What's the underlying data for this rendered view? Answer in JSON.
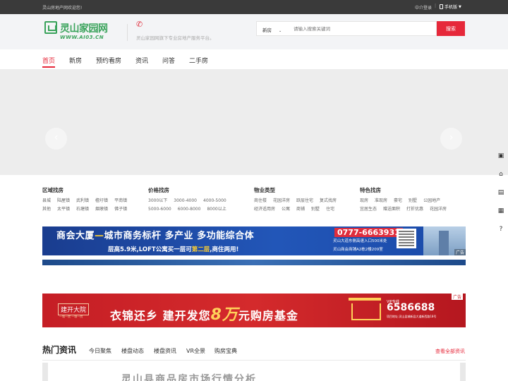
{
  "topbar": {
    "welcome": "灵山房地产网欢迎您!",
    "login": "中介登录",
    "separator": "|",
    "mobile": "手机版"
  },
  "header": {
    "logo_cn": "灵山家园网",
    "logo_en": "WWW.AI03.CN",
    "slogan": "灵山家园网旗下专业房地产服务平台。",
    "search": {
      "type_selected": "新房",
      "placeholder": "请输入搜索关键词",
      "button": "搜索"
    }
  },
  "nav": {
    "items": [
      {
        "label": "首页",
        "active": true
      },
      {
        "label": "新房"
      },
      {
        "label": "预约看房"
      },
      {
        "label": "资讯"
      },
      {
        "label": "问答"
      },
      {
        "label": "二手房"
      }
    ]
  },
  "banner": {
    "prev_icon": "chevron-left-icon",
    "next_icon": "chevron-right-icon"
  },
  "sidebar": {
    "icons": [
      "building-icon",
      "home-icon",
      "box-icon",
      "document-icon",
      "help-icon"
    ]
  },
  "categories": [
    {
      "title": "区域找房",
      "links": [
        "县城",
        "陆屋镇",
        "武利镇",
        "檀圩镇",
        "平南镇",
        "其他",
        "太平镇",
        "石塘镇",
        "烟墩镇",
        "佛子镇"
      ]
    },
    {
      "title": "价格找房",
      "links": [
        "3000以下",
        "3000-4000",
        "4000-5000",
        "5000-6000",
        "6000-8000",
        "8000以上"
      ]
    },
    {
      "title": "物业类型",
      "links": [
        "商住楼",
        "花园洋房",
        "跃层住宅",
        "复式找房",
        "经济适用房",
        "公寓",
        "商铺",
        "别墅",
        "住宅"
      ]
    },
    {
      "title": "特色找房",
      "links": [
        "现房",
        "准现房",
        "豪宅",
        "别墅",
        "公园地产",
        "宜居生态",
        "赠送面积",
        "打折优惠",
        "花园洋房"
      ]
    }
  ],
  "ad1": {
    "headline_a": "商会大厦",
    "headline_dash": "—",
    "headline_b": "城市商务标杆 多产业 多功能综合体",
    "sub_a": "层高5.9米,LOFT公寓买一层可",
    "sub_hl": "第二层",
    "sub_b": ",商住两用!",
    "tel": "0777-6663931",
    "addr1": "灵山大道东侧高速入口500米处",
    "addr2": "灵山商会商铺A2栋2楼209室",
    "tag": "广告"
  },
  "ad2": {
    "brand": "建开大院",
    "brand_sub": "一城一院 一城一院",
    "slogan_a": "衣锦还乡  建开发您",
    "slogan_big": "8万",
    "slogan_b": "元购房基金",
    "hotline": "VIP专线",
    "num": "6586688",
    "addr": "项目地址:灵山县城新县大道新西路18号",
    "tag": "广告"
  },
  "news": {
    "title": "热门资讯",
    "tabs": [
      "今日聚焦",
      "楼盘动态",
      "楼盘资讯",
      "VR全景",
      "购房宝典"
    ],
    "more": "查看全部资讯",
    "headline": "灵山县商品房市场行情分析"
  },
  "colors": {
    "brand_red": "#e6283a",
    "brand_green": "#3aa35b"
  }
}
